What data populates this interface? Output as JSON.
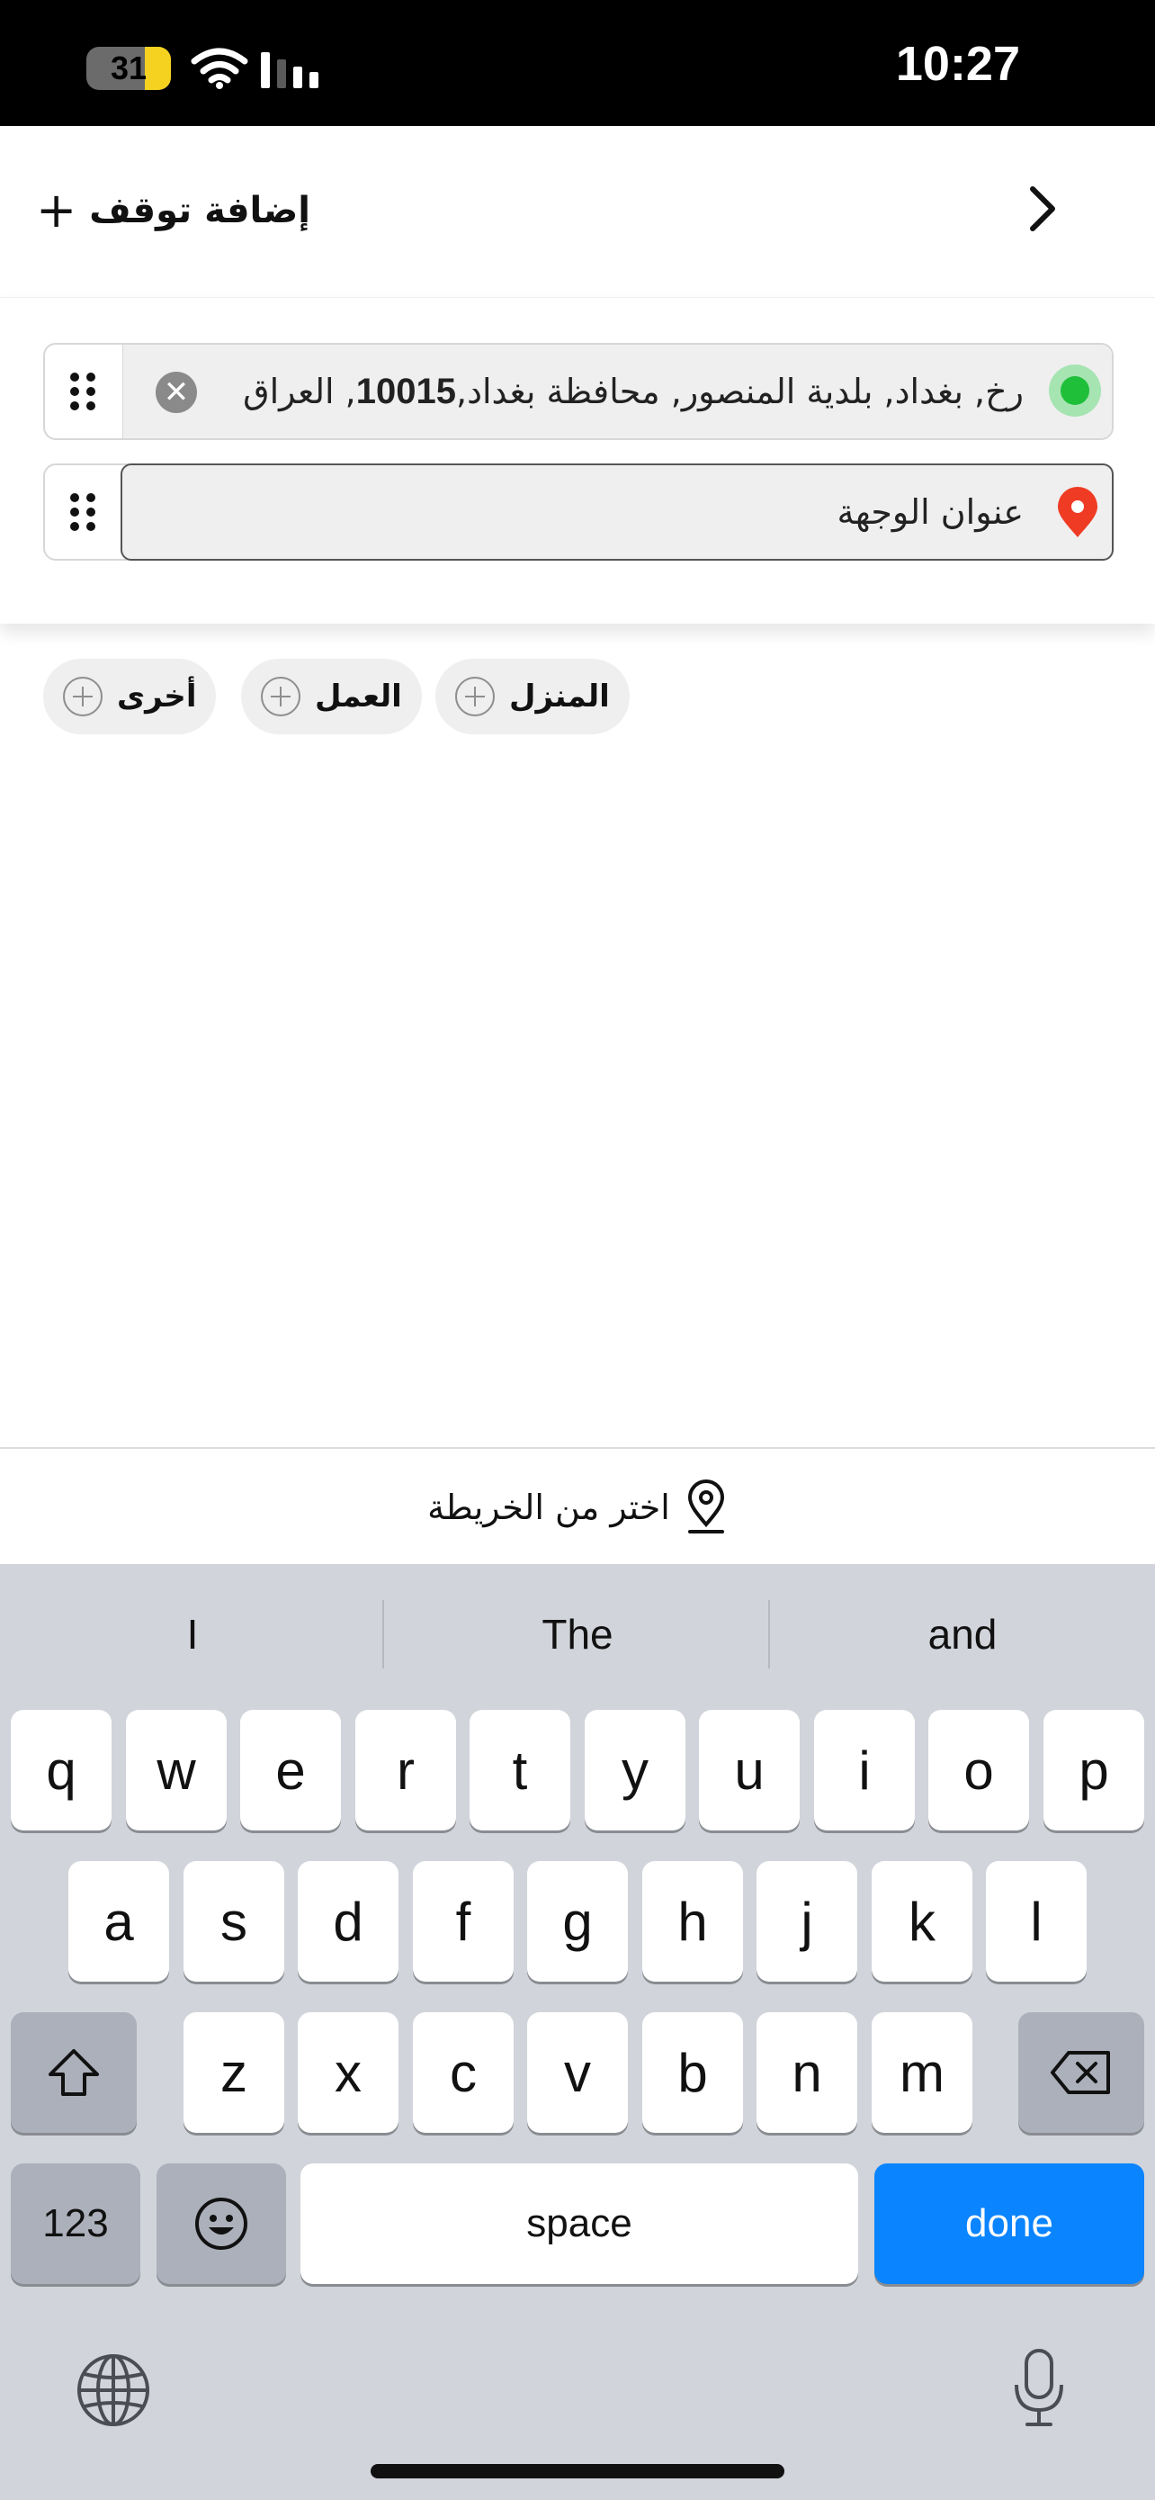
{
  "status_bar": {
    "time": "10:27",
    "battery_level": "31",
    "battery_fraction": 0.31
  },
  "header": {
    "add_stop_label": "إضافة توقف",
    "add_stop_icon": "plus-icon",
    "back_icon": "chevron-right-icon"
  },
  "route": {
    "origin": {
      "address_part1": "رخ, بغداد, بلدية المنصور, محافظة بغداد, ",
      "postal": "10015",
      "address_part2": ", العراق"
    },
    "destination": {
      "placeholder": "عنوان الوجهة"
    }
  },
  "shortcuts": [
    {
      "label": "المنزل"
    },
    {
      "label": "العمل"
    },
    {
      "label": "أخرى"
    }
  ],
  "map_picker": {
    "label": "اختر من الخريطة"
  },
  "keyboard": {
    "suggestions": [
      "I",
      "The",
      "and"
    ],
    "row1": [
      "q",
      "w",
      "e",
      "r",
      "t",
      "y",
      "u",
      "i",
      "o",
      "p"
    ],
    "row2": [
      "a",
      "s",
      "d",
      "f",
      "g",
      "h",
      "j",
      "k",
      "l"
    ],
    "row3": [
      "z",
      "x",
      "c",
      "v",
      "b",
      "n",
      "m"
    ],
    "numbers_label": "123",
    "space_label": "space",
    "done_label": "done"
  },
  "colors": {
    "accent": "#0a84ff",
    "origin_dot": "#1fbf3a",
    "destination_pin": "#ef3b24",
    "battery": "#f4d21f"
  }
}
